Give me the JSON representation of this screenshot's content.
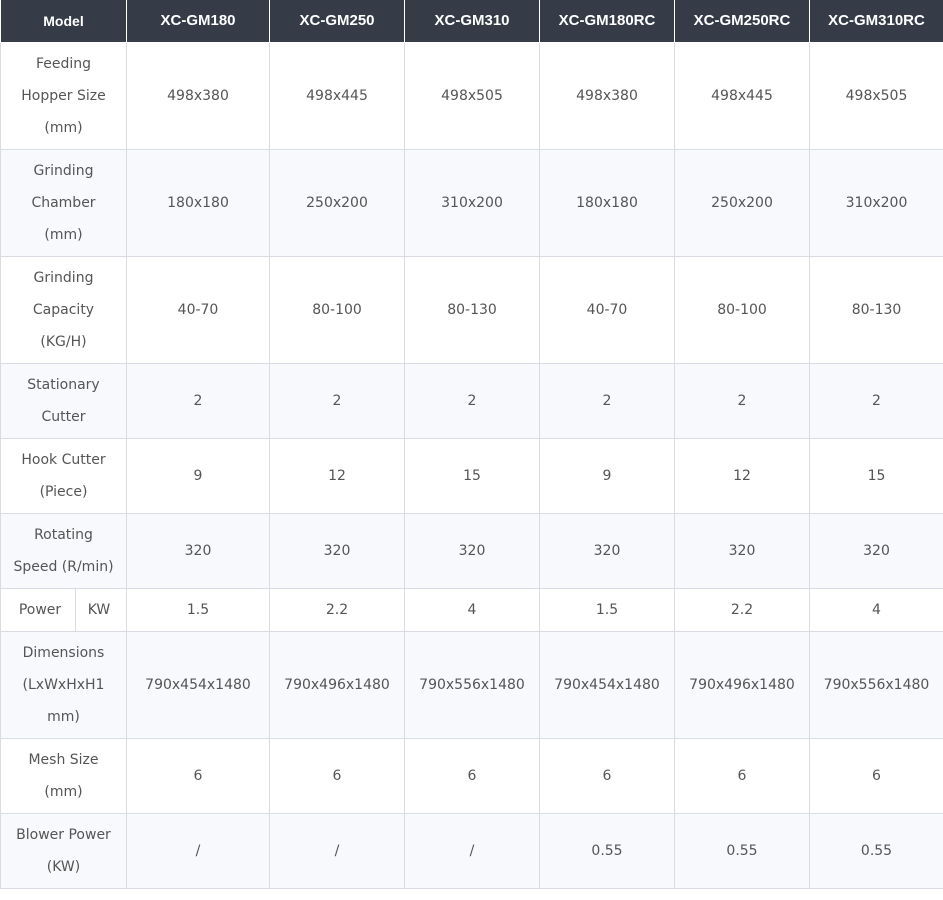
{
  "header": {
    "model": "Model",
    "models": [
      "XC-GM180",
      "XC-GM250",
      "XC-GM310",
      "XC-GM180RC",
      "XC-GM250RC",
      "XC-GM310RC"
    ]
  },
  "rows": [
    {
      "label": [
        "Feeding",
        "Hopper Size",
        "(mm)"
      ],
      "values": [
        "498x380",
        "498x445",
        "498x505",
        "498x380",
        "498x445",
        "498x505"
      ]
    },
    {
      "label": [
        "Grinding",
        "Chamber",
        "(mm)"
      ],
      "values": [
        "180x180",
        "250x200",
        "310x200",
        "180x180",
        "250x200",
        "310x200"
      ]
    },
    {
      "label": [
        "Grinding",
        "Capacity",
        "(KG/H)"
      ],
      "values": [
        "40-70",
        "80-100",
        "80-130",
        "40-70",
        "80-100",
        "80-130"
      ]
    },
    {
      "label": [
        "Stationary",
        "Cutter"
      ],
      "values": [
        "2",
        "2",
        "2",
        "2",
        "2",
        "2"
      ]
    },
    {
      "label": [
        "Hook Cutter",
        "(Piece)"
      ],
      "values": [
        "9",
        "12",
        "15",
        "9",
        "12",
        "15"
      ]
    },
    {
      "label": [
        "Rotating",
        "Speed (R/min)"
      ],
      "values": [
        "320",
        "320",
        "320",
        "320",
        "320",
        "320"
      ]
    },
    {
      "label": [
        "Power",
        "KW"
      ],
      "values": [
        "1.5",
        "2.2",
        "4",
        "1.5",
        "2.2",
        "4"
      ]
    },
    {
      "label": [
        "Dimensions",
        "(LxWxHxH1",
        "mm)"
      ],
      "values": [
        "790x454x1480",
        "790x496x1480",
        "790x556x1480",
        "790x454x1480",
        "790x496x1480",
        "790x556x1480"
      ]
    },
    {
      "label": [
        "Mesh Size",
        "(mm)"
      ],
      "values": [
        "6",
        "6",
        "6",
        "6",
        "6",
        "6"
      ]
    },
    {
      "label": [
        "Blower Power",
        "(KW)"
      ],
      "values": [
        "/",
        "/",
        "/",
        "0.55",
        "0.55",
        "0.55"
      ]
    }
  ]
}
